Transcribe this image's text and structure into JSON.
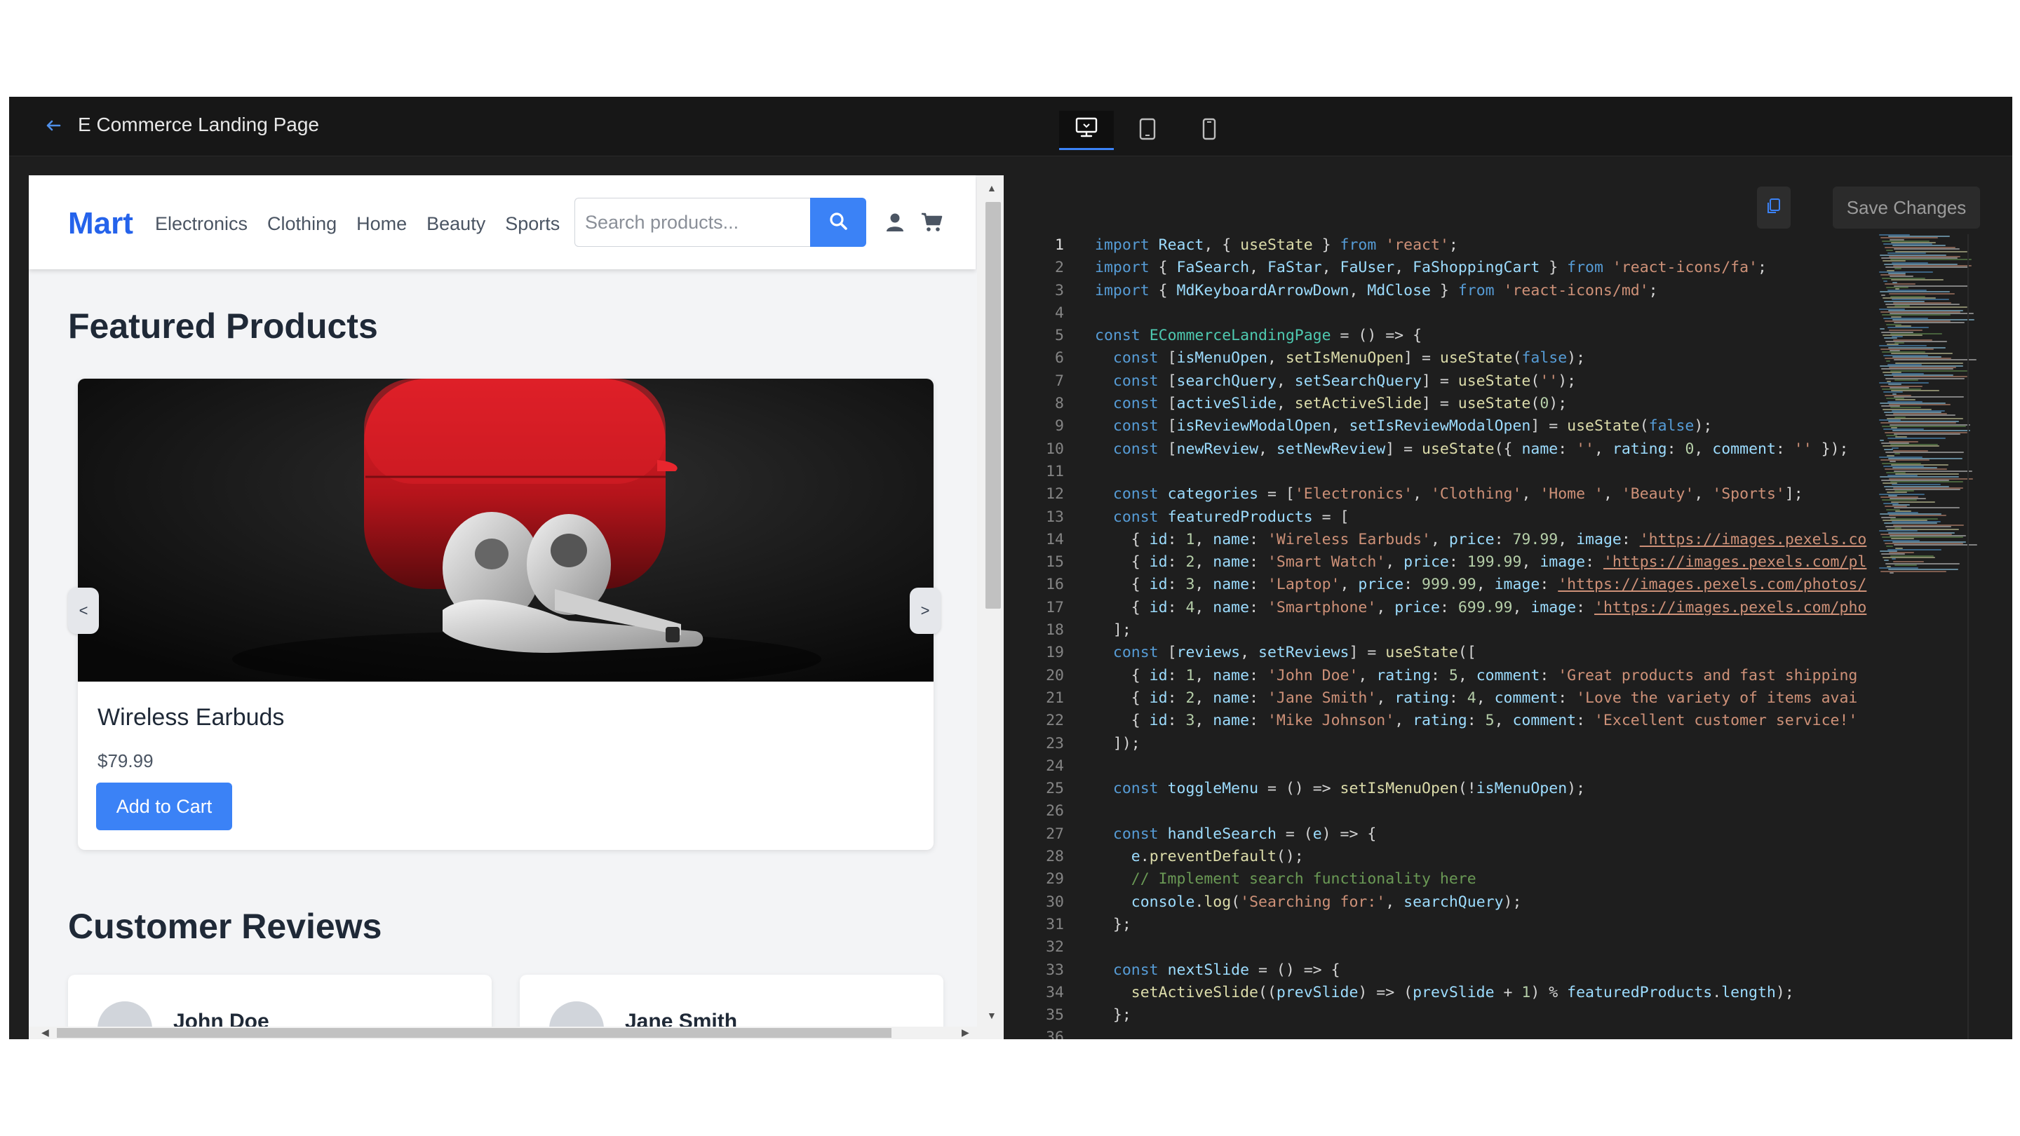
{
  "header": {
    "title": "E Commerce Landing Page",
    "devices": [
      "desktop",
      "tablet",
      "mobile"
    ],
    "active_device": "desktop"
  },
  "preview": {
    "brand": "Mart",
    "nav": [
      "Electronics",
      "Clothing",
      "Home",
      "Beauty",
      "Sports"
    ],
    "search_placeholder": "Search products...",
    "featured_title": "Featured Products",
    "product": {
      "name": "Wireless Earbuds",
      "price": "$79.99",
      "cta": "Add to Cart"
    },
    "carousel_prev": "<",
    "carousel_next": ">",
    "reviews_title": "Customer Reviews",
    "reviewers": [
      "John Doe",
      "Jane Smith"
    ]
  },
  "editor": {
    "save_label": "Save Changes",
    "current_line": 1,
    "lines": [
      "import React, { useState } from 'react';",
      "import { FaSearch, FaStar, FaUser, FaShoppingCart } from 'react-icons/fa';",
      "import { MdKeyboardArrowDown, MdClose } from 'react-icons/md';",
      "",
      "const ECommerceLandingPage = () => {",
      "  const [isMenuOpen, setIsMenuOpen] = useState(false);",
      "  const [searchQuery, setSearchQuery] = useState('');",
      "  const [activeSlide, setActiveSlide] = useState(0);",
      "  const [isReviewModalOpen, setIsReviewModalOpen] = useState(false);",
      "  const [newReview, setNewReview] = useState({ name: '', rating: 0, comment: '' });",
      "",
      "  const categories = ['Electronics', 'Clothing', 'Home ', 'Beauty', 'Sports'];",
      "  const featuredProducts = [",
      "    { id: 1, name: 'Wireless Earbuds', price: 79.99, image: 'https://images.pexels.co",
      "    { id: 2, name: 'Smart Watch', price: 199.99, image: 'https://images.pexels.com/pl",
      "    { id: 3, name: 'Laptop', price: 999.99, image: 'https://images.pexels.com/photos/",
      "    { id: 4, name: 'Smartphone', price: 699.99, image: 'https://images.pexels.com/pho",
      "  ];",
      "  const [reviews, setReviews] = useState([",
      "    { id: 1, name: 'John Doe', rating: 5, comment: 'Great products and fast shipping",
      "    { id: 2, name: 'Jane Smith', rating: 4, comment: 'Love the variety of items avai",
      "    { id: 3, name: 'Mike Johnson', rating: 5, comment: 'Excellent customer service!'",
      "  ]);",
      "",
      "  const toggleMenu = () => setIsMenuOpen(!isMenuOpen);",
      "",
      "  const handleSearch = (e) => {",
      "    e.preventDefault();",
      "    // Implement search functionality here",
      "    console.log('Searching for:', searchQuery);",
      "  };",
      "",
      "  const nextSlide = () => {",
      "    setActiveSlide((prevSlide) => (prevSlide + 1) % featuredProducts.length);",
      "  };",
      ""
    ]
  }
}
